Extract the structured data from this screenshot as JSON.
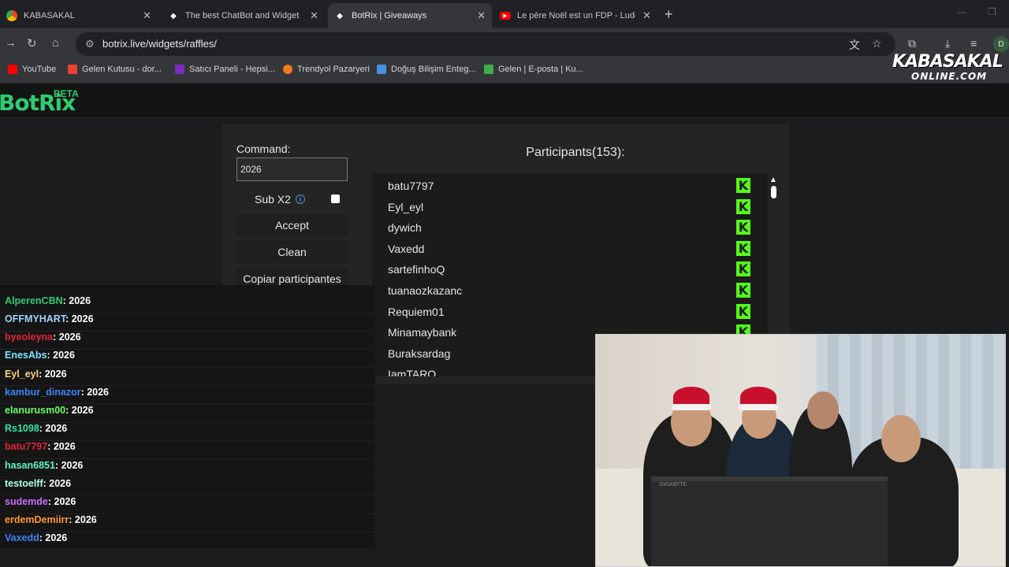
{
  "browser": {
    "tabs": [
      {
        "title": "KABASAKAL",
        "active": false
      },
      {
        "title": "The best ChatBot and Widgets",
        "active": false
      },
      {
        "title": "BotRix | Giveaways",
        "active": true
      },
      {
        "title": "Le père Noël est un FDP - Ludo",
        "active": false
      }
    ],
    "url": "botrix.live/widgets/raffles/",
    "bookmarks": [
      {
        "label": "YouTube",
        "color": "#ff0000"
      },
      {
        "label": "Gelen Kutusu - dor...",
        "color": "#ea4335"
      },
      {
        "label": "Satıcı Paneli - Hepsi...",
        "color": "#7b2cbf"
      },
      {
        "label": "Trendyol Pazaryeri",
        "color": "#f27a1a"
      },
      {
        "label": "Doğuş Bilişim Enteg...",
        "color": "#4a90e2"
      },
      {
        "label": "Gelen | E-posta | Ku...",
        "color": "#3fae49"
      }
    ],
    "avatar_letter": "D"
  },
  "overlay": {
    "logo_line1": "KABASAKAL",
    "logo_line2": "ONLINE.COM"
  },
  "site": {
    "brand": "BotRix",
    "badge": "BETA"
  },
  "raffle": {
    "command_label": "Command:",
    "command_value": "2026",
    "subx2_label": "Sub X2",
    "subx2_checked": false,
    "accept_label": "Accept",
    "clean_label": "Clean",
    "copy_label": "Copiar participantes",
    "participants_title": "Participants(153):",
    "participants": [
      "batu7797",
      "Eyl_eyl",
      "dywich",
      "Vaxedd",
      "sartefinhoQ",
      "tuanaozkazanc",
      "Requiem01",
      "Minamaybank",
      "Buraksardag",
      "IamTARO"
    ],
    "platform_icon": "kick-icon",
    "platform_color": "#53fc18"
  },
  "chat": {
    "messages": [
      {
        "user": "AlperenCBN",
        "text": ": 2026",
        "color": "#2ecc71"
      },
      {
        "user": "OFFMYHART",
        "text": ": 2026",
        "color": "#9fd3ff"
      },
      {
        "user": "byeoleyna",
        "text": ": 2026",
        "color": "#e0243a"
      },
      {
        "user": "EnesAbs",
        "text": ": 2026",
        "color": "#7fe3ff"
      },
      {
        "user": "Eyl_eyl",
        "text": ": 2026",
        "color": "#ffd27f"
      },
      {
        "user": "kambur_dinazor",
        "text": ": 2026",
        "color": "#3b82f6"
      },
      {
        "user": "elanurusm00",
        "text": ": 2026",
        "color": "#66ff66"
      },
      {
        "user": "Rs1098",
        "text": ": 2026",
        "color": "#2ee6a8"
      },
      {
        "user": "batu7797",
        "text": ": 2026",
        "color": "#e0243a"
      },
      {
        "user": "hasan6851",
        "text": ": 2026",
        "color": "#5ff2c5"
      },
      {
        "user": "testoelff",
        "text": ": 2026",
        "color": "#b0ffe0"
      },
      {
        "user": "sudemde",
        "text": ": 2026",
        "color": "#c96cff"
      },
      {
        "user": "erdemDemiirr",
        "text": ": 2026",
        "color": "#ff9a2e"
      },
      {
        "user": "Vaxedd",
        "text": ": 2026",
        "color": "#3b82f6"
      }
    ]
  },
  "webcam": {
    "monitor_brand": "GIGABYTE"
  }
}
